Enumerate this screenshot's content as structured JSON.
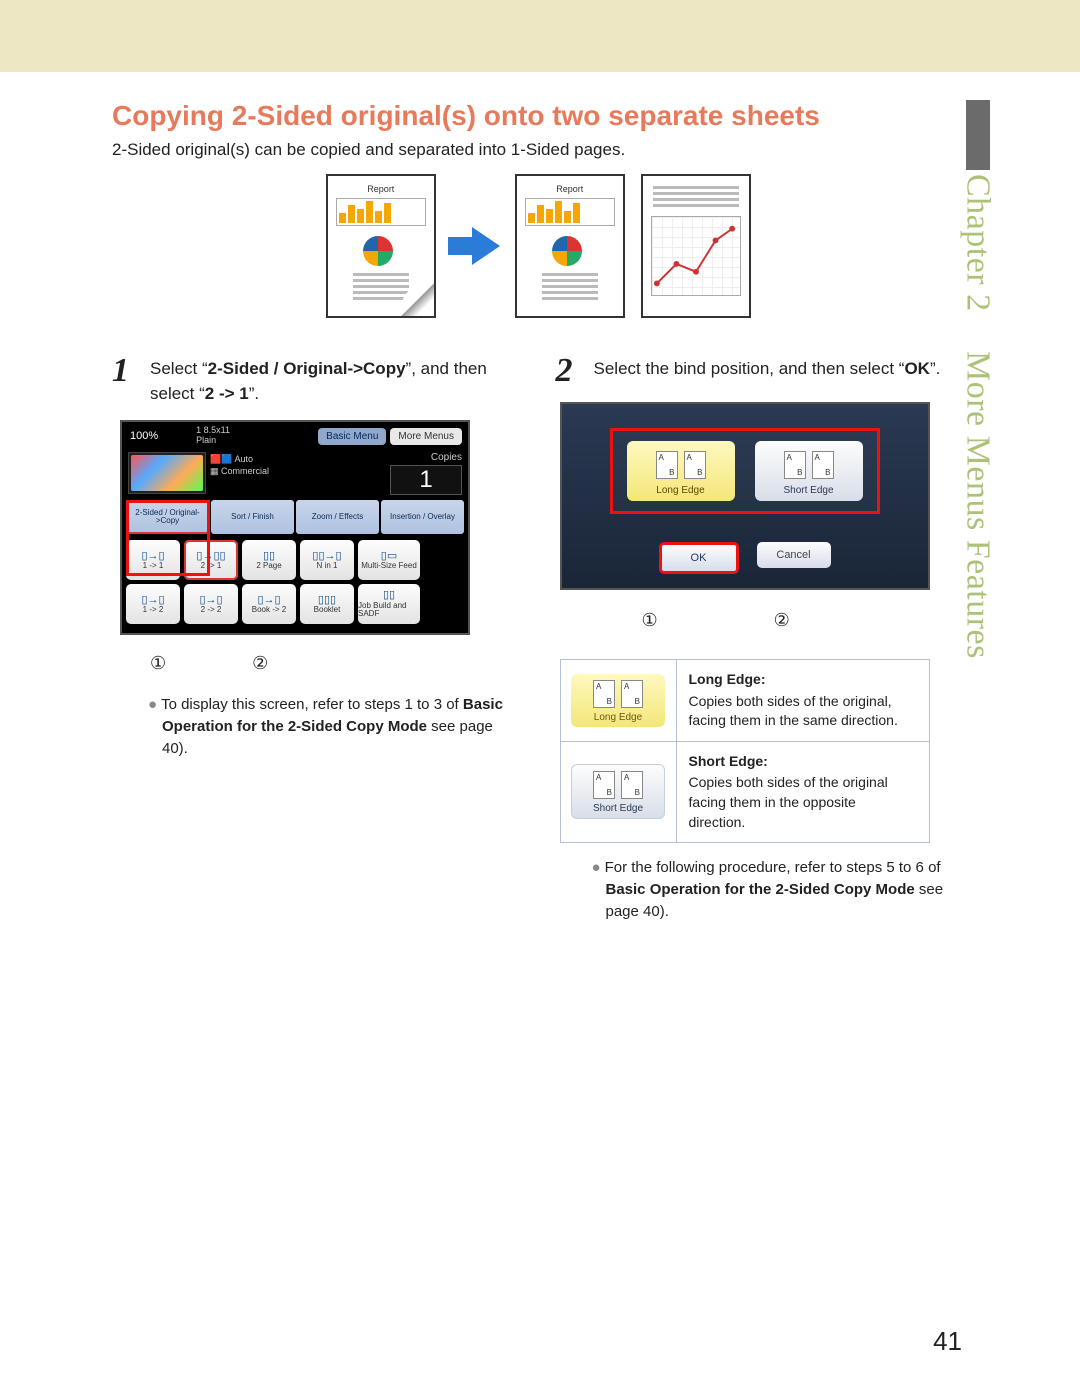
{
  "sidebar": {
    "chapter": "Chapter 2",
    "section": "More Menus Features"
  },
  "title": "Copying 2-Sided original(s) onto two separate sheets",
  "intro": "2-Sided original(s) can be copied and separated into 1-Sided pages.",
  "diagram": {
    "doc_title": "Report"
  },
  "step1": {
    "num": "1",
    "text_a": "Select “",
    "bold_a": "2-Sided / Original->Copy",
    "text_b": "”, and then select “",
    "bold_b": "2 -> 1",
    "text_c": "”."
  },
  "screen1": {
    "pct": "100%",
    "paper_line1": "1 8.5x11",
    "paper_line2": "Plain",
    "basic_menu": "Basic Menu",
    "more_menus": "More Menus",
    "auto": "Auto",
    "commercial": "Commercial",
    "copies_lbl": "Copies",
    "copies_val": "1",
    "tabs": [
      "2-Sided / Original->Copy",
      "Sort / Finish",
      "Zoom / Effects",
      "Insertion / Overlay"
    ],
    "row1": [
      "1 -> 1",
      "2 -> 1",
      "2 Page",
      "N in 1",
      "Multi-Size Feed"
    ],
    "row2": [
      "1 -> 2",
      "2 -> 2",
      "Book -> 2",
      "Booklet",
      "Job Build and SADF"
    ]
  },
  "circled": {
    "one": "①",
    "two": "②"
  },
  "note1": {
    "lead": "To display this screen, refer to steps 1 to 3 of ",
    "bold": "Basic Operation for the 2-Sided Copy Mode",
    "tail": " see page 40)."
  },
  "step2": {
    "num": "2",
    "text_a": "Select the bind position, and then select “",
    "bold": "OK",
    "text_b": "”."
  },
  "screen2": {
    "long": "Long Edge",
    "short": "Short Edge",
    "ok": "OK",
    "cancel": "Cancel"
  },
  "edge_table": {
    "long": {
      "title": "Long Edge:",
      "desc": "Copies both sides of the original, facing them in the same direction.",
      "btn": "Long Edge"
    },
    "short": {
      "title": "Short Edge:",
      "desc": "Copies both sides of the original facing them in the opposite direction.",
      "btn": "Short Edge"
    }
  },
  "note2": {
    "lead": "For the following procedure, refer to steps 5 to 6 of ",
    "bold": "Basic Operation for the 2-Sided Copy Mode",
    "tail": " see page 40)."
  },
  "page_number": "41"
}
